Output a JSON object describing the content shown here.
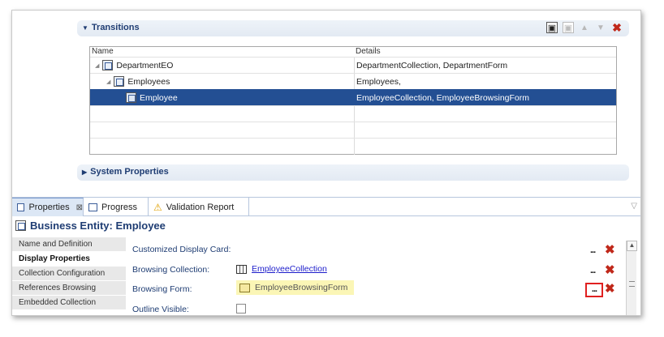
{
  "sections": {
    "transitions_label": "Transitions",
    "system_properties_label": "System Properties"
  },
  "toolbar_icons": [
    "add-entity-icon",
    "edit-entity-icon",
    "move-up-icon",
    "move-down-icon",
    "delete-icon"
  ],
  "tree": {
    "col_name": "Name",
    "col_details": "Details",
    "rows": [
      {
        "name": "DepartmentEO",
        "details": "DepartmentCollection, DepartmentForm"
      },
      {
        "name": "Employees",
        "details": "Employees,"
      },
      {
        "name": "Employee",
        "details": "EmployeeCollection, EmployeeBrowsingForm"
      }
    ]
  },
  "tabs": {
    "properties": "Properties",
    "progress": "Progress",
    "validation": "Validation Report"
  },
  "props": {
    "title": "Business Entity: Employee",
    "nav": [
      "Name and Definition",
      "Display Properties",
      "Collection Configuration",
      "References Browsing",
      "Embedded Collection"
    ],
    "fields": {
      "display_card_label": "Customized Display Card:",
      "browsing_collection_label": "Browsing Collection:",
      "browsing_collection_value": "EmployeeCollection",
      "browsing_form_label": "Browsing Form:",
      "browsing_form_value": "EmployeeBrowsingForm",
      "outline_visible_label": "Outline Visible:"
    },
    "ellipsis": "...",
    "outline_visible_checked": false
  },
  "colors": {
    "selection": "#234f93",
    "heading": "#1f3d73",
    "delete": "#c0281a",
    "highlight": "#fbf6b6",
    "callout": "#e02020"
  }
}
